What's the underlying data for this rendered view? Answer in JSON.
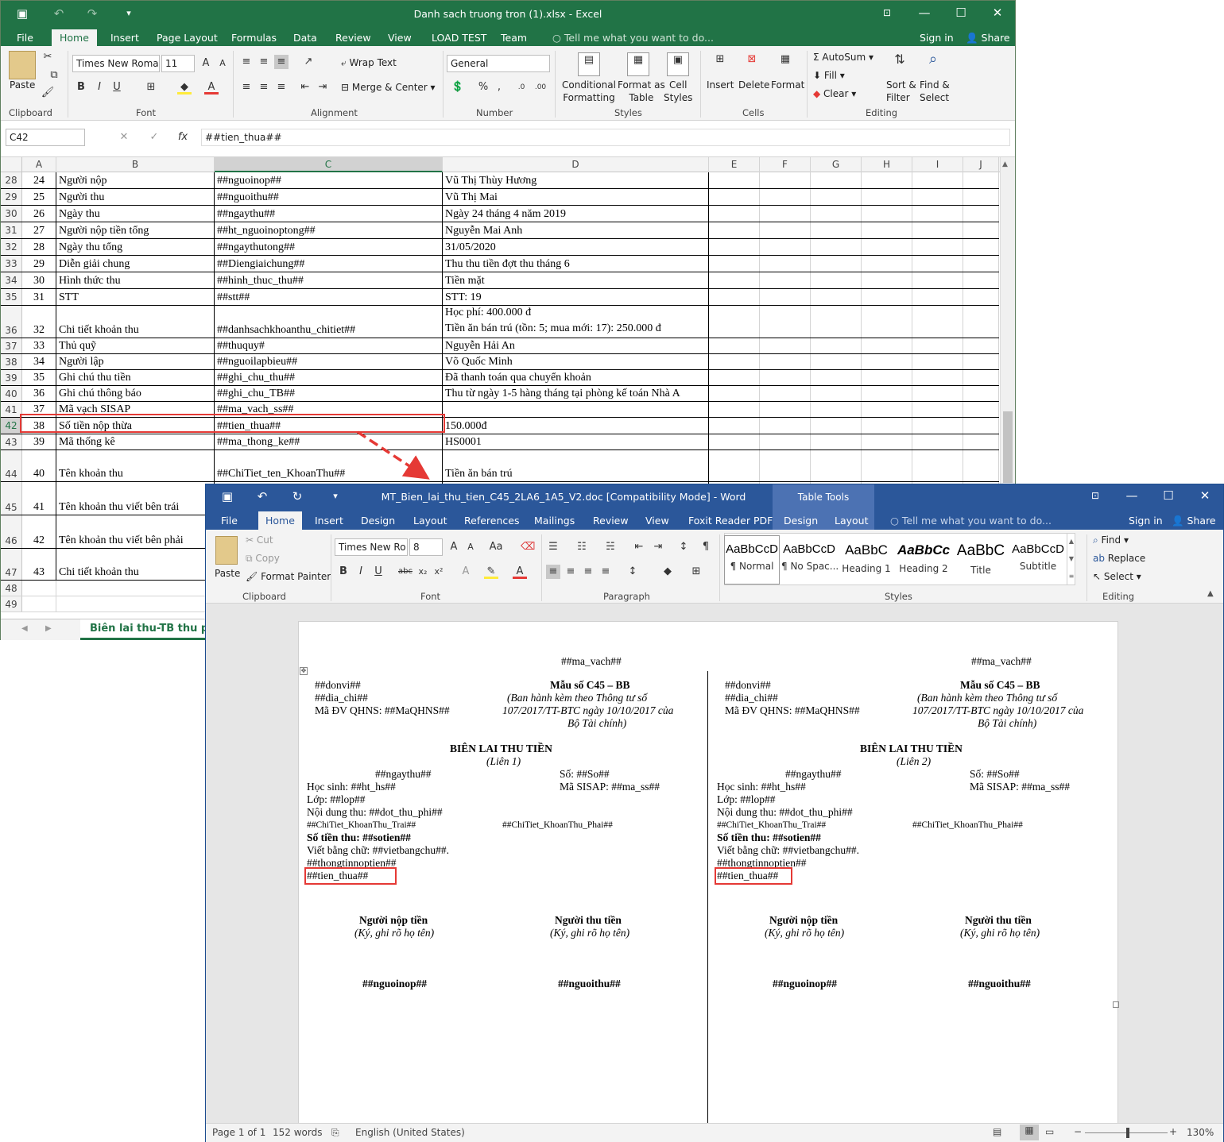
{
  "excel": {
    "title": "Danh sach truong tron (1).xlsx - Excel",
    "tabs": [
      "File",
      "Home",
      "Insert",
      "Page Layout",
      "Formulas",
      "Data",
      "Review",
      "View",
      "LOAD TEST",
      "Team"
    ],
    "tell_me": "Tell me what you want to do...",
    "sign_in": "Sign in",
    "share": "Share",
    "ribbon": {
      "paste": "Paste",
      "font_name": "Times New Roma",
      "font_size": "11",
      "wrap_text": "Wrap Text",
      "merge_center": "Merge & Center",
      "number_format": "General",
      "conditional": [
        "Conditional",
        "Formatting"
      ],
      "format_table": [
        "Format as",
        "Table"
      ],
      "cell_styles": [
        "Cell",
        "Styles"
      ],
      "insert": "Insert",
      "delete": "Delete",
      "format": "Format",
      "autosum": "AutoSum",
      "fill": "Fill",
      "clear": "Clear",
      "sort": [
        "Sort &",
        "Filter"
      ],
      "find": [
        "Find &",
        "Select"
      ],
      "groups": [
        "Clipboard",
        "Font",
        "Alignment",
        "Number",
        "Styles",
        "Cells",
        "Editing"
      ]
    },
    "name_box": "C42",
    "formula": "##tien_thua##",
    "columns": [
      "A",
      "B",
      "C",
      "D",
      "E",
      "F",
      "G",
      "H",
      "I",
      "J"
    ],
    "rows": [
      {
        "r": "28",
        "a": "24",
        "b": "Người nộp",
        "c": "##nguoinop##",
        "d": "Vũ Thị Thùy Hương"
      },
      {
        "r": "29",
        "a": "25",
        "b": "Người thu",
        "c": "##nguoithu##",
        "d": "Vũ Thị Mai"
      },
      {
        "r": "30",
        "a": "26",
        "b": "Ngày thu",
        "c": "##ngaythu##",
        "d": "Ngày 24 tháng 4 năm 2019"
      },
      {
        "r": "31",
        "a": "27",
        "b": "Người nộp tiền tổng",
        "c": "##ht_nguoinoptong##",
        "d": "Nguyễn Mai Anh"
      },
      {
        "r": "32",
        "a": "28",
        "b": "Ngày thu tổng",
        "c": "##ngaythutong##",
        "d": "31/05/2020"
      },
      {
        "r": "33",
        "a": "29",
        "b": "Diễn giải chung",
        "c": "##Diengiaichung##",
        "d": "Thu thu tiền đợt thu tháng 6"
      },
      {
        "r": "34",
        "a": "30",
        "b": "Hình thức thu",
        "c": "##hinh_thuc_thu##",
        "d": "Tiền mặt"
      },
      {
        "r": "35",
        "a": "31",
        "b": "STT",
        "c": "##stt##",
        "d": "STT: 19"
      },
      {
        "r": "36",
        "a": "32",
        "b": "Chi tiết khoản thu",
        "c": "##danhsachkhoanthu_chitiet##",
        "d": "Học phí: 400.000 đ",
        "d2": "Tiền ăn bán trú (tồn: 5; mua mới: 17): 250.000 đ"
      },
      {
        "r": "37",
        "a": "33",
        "b": "Thủ quỹ",
        "c": "##thuquy#",
        "d": "Nguyễn Hải An"
      },
      {
        "r": "38",
        "a": "34",
        "b": "Người lập",
        "c": "##nguoilapbieu##",
        "d": "Võ Quốc Minh"
      },
      {
        "r": "39",
        "a": "35",
        "b": "Ghi chú thu tiền",
        "c": "##ghi_chu_thu##",
        "d": "Đã thanh toán qua chuyển khoản"
      },
      {
        "r": "40",
        "a": "36",
        "b": "Ghi chú thông báo",
        "c": "##ghi_chu_TB##",
        "d": "Thu từ ngày 1-5 hàng tháng tại phòng kế toán Nhà A"
      },
      {
        "r": "41",
        "a": "37",
        "b": "Mã vạch SISAP",
        "c": "##ma_vach_ss##",
        "d": ""
      },
      {
        "r": "42",
        "a": "38",
        "b": "Số tiền nộp thừa",
        "c": "##tien_thua##",
        "d": "150.000đ"
      },
      {
        "r": "43",
        "a": "39",
        "b": "Mã thống kê",
        "c": "##ma_thong_ke##",
        "d": "HS0001"
      },
      {
        "r": "44",
        "a": "40",
        "b": "Tên khoản thu",
        "c": "##ChiTiet_ten_KhoanThu##",
        "d": "Tiền ăn bán trú"
      },
      {
        "r": "45",
        "a": "41",
        "b": "Tên khoản thu viết bên trái",
        "c": "",
        "d": ""
      },
      {
        "r": "46",
        "a": "42",
        "b": "Tên khoản thu viết bên phải",
        "c": "",
        "d": ""
      },
      {
        "r": "47",
        "a": "43",
        "b": "Chi tiết khoản thu",
        "c": "",
        "d": ""
      },
      {
        "r": "48",
        "a": "",
        "b": "",
        "c": "",
        "d": ""
      },
      {
        "r": "49",
        "a": "",
        "b": "",
        "c": "",
        "d": ""
      }
    ],
    "sheet_tab": "Biên lai thu-TB thu phí-"
  },
  "word": {
    "title": "MT_Bien_lai_thu_tien_C45_2LA6_1A5_V2.doc [Compatibility Mode] - Word",
    "table_tools": "Table Tools",
    "tabs": [
      "File",
      "Home",
      "Insert",
      "Design",
      "Layout",
      "References",
      "Mailings",
      "Review",
      "View",
      "Foxit Reader PDF"
    ],
    "context_tabs": [
      "Design",
      "Layout"
    ],
    "tell_me": "Tell me what you want to do...",
    "sign_in": "Sign in",
    "share": "Share",
    "ribbon": {
      "paste": "Paste",
      "cut": "Cut",
      "copy": "Copy",
      "format_painter": "Format Painter",
      "font_name": "Times New Ro",
      "font_size": "8",
      "find": "Find",
      "replace": "Replace",
      "select": "Select",
      "groups": [
        "Clipboard",
        "Font",
        "Paragraph",
        "Styles",
        "Editing"
      ],
      "styles": [
        {
          "preview": "AaBbCcD",
          "name": "¶ Normal"
        },
        {
          "preview": "AaBbCcD",
          "name": "¶ No Spac..."
        },
        {
          "preview": "AaBbC",
          "name": "Heading 1"
        },
        {
          "preview": "AaBbCc",
          "name": "Heading 2"
        },
        {
          "preview": "AaBbC",
          "name": "Title"
        },
        {
          "preview": "AaBbCcD",
          "name": "Subtitle"
        }
      ]
    },
    "doc": {
      "ma_vach": "##ma_vach##",
      "donvi": "##donvi##",
      "dia_chi": "##dia_chi##",
      "ma_dv": "Mã ĐV QHNS: ##MaQHNS##",
      "mau_so": "Mẫu số C45 – BB",
      "ban_hanh_1": "(Ban hành kèm theo Thông tư số",
      "ban_hanh_2": "107/2017/TT-BTC ngày 10/10/2017 của",
      "ban_hanh_3": "Bộ Tài chính)",
      "heading": "BIÊN LAI THU TIỀN",
      "lien1": "(Liên 1)",
      "lien2": "(Liên 2)",
      "ngaythu": "##ngaythu##",
      "so": "Số: ##So##",
      "hoc_sinh": "Học sinh: ##ht_hs##",
      "ma_sisap": "Mã SISAP: ##ma_ss##",
      "lop": "Lớp: ##lop##",
      "noi_dung": "Nội dung thu: ##dot_thu_phi##",
      "kt_trai": "##ChiTiet_KhoanThu_Trai##",
      "kt_phai": "##ChiTiet_KhoanThu_Phai##",
      "so_tien": "Số tiền thu: ##sotien##",
      "viet_bang_chu": "Viết bằng chữ: ##vietbangchu##.",
      "thong_tin": "##thongtinnoptien##",
      "tien_thua": "##tien_thua##",
      "nguoi_nop_tien": "Người nộp tiền",
      "nguoi_thu_tien": "Người thu tiền",
      "ky": "(Ký, ghi rõ họ tên)",
      "nguoinop": "##nguoinop##",
      "nguoithu": "##nguoithu##"
    },
    "status": {
      "page": "Page 1 of 1",
      "words": "152 words",
      "language": "English (United States)",
      "zoom": "130%"
    }
  }
}
